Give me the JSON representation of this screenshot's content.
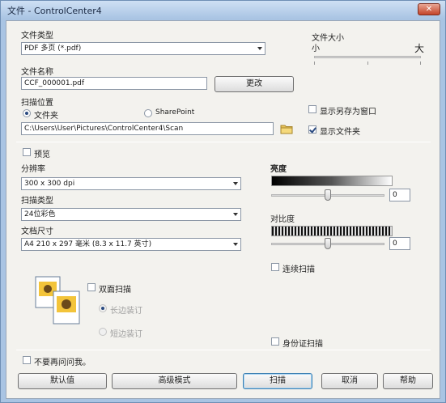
{
  "window": {
    "title": "文件 - ControlCenter4",
    "close_glyph": "✕"
  },
  "file_type": {
    "label": "文件类型",
    "value": "PDF 多页 (*.pdf)"
  },
  "file_size": {
    "label": "文件大小",
    "min_label": "小",
    "max_label": "大"
  },
  "file_name": {
    "label": "文件名称",
    "value": "CCF_000001.pdf",
    "change_button": "更改"
  },
  "scan_location": {
    "label": "扫描位置",
    "folder_option": "文件夹",
    "sharepoint_option": "SharePoint",
    "path": "C:\\Users\\User\\Pictures\\ControlCenter4\\Scan"
  },
  "options": {
    "show_save_as": "显示另存为窗口",
    "show_folder": "显示文件夹",
    "preview": "预览",
    "continuous_scan": "连续扫描",
    "duplex_scan": "双面扫描",
    "long_edge": "长边装订",
    "short_edge": "短边装订",
    "id_card_scan": "身份证扫描",
    "dont_show_again": "不要再问问我。"
  },
  "resolution": {
    "label": "分辨率",
    "value": "300 x 300 dpi"
  },
  "scan_type": {
    "label": "扫描类型",
    "value": "24位彩色"
  },
  "document_size": {
    "label": "文档尺寸",
    "value": "A4 210 x 297 毫米 (8.3 x 11.7 英寸)"
  },
  "brightness": {
    "label": "亮度",
    "value": "0"
  },
  "contrast": {
    "label": "对比度",
    "value": "0"
  },
  "buttons": {
    "default": "默认值",
    "advanced": "高级模式",
    "scan": "扫描",
    "cancel": "取消",
    "help": "帮助"
  }
}
